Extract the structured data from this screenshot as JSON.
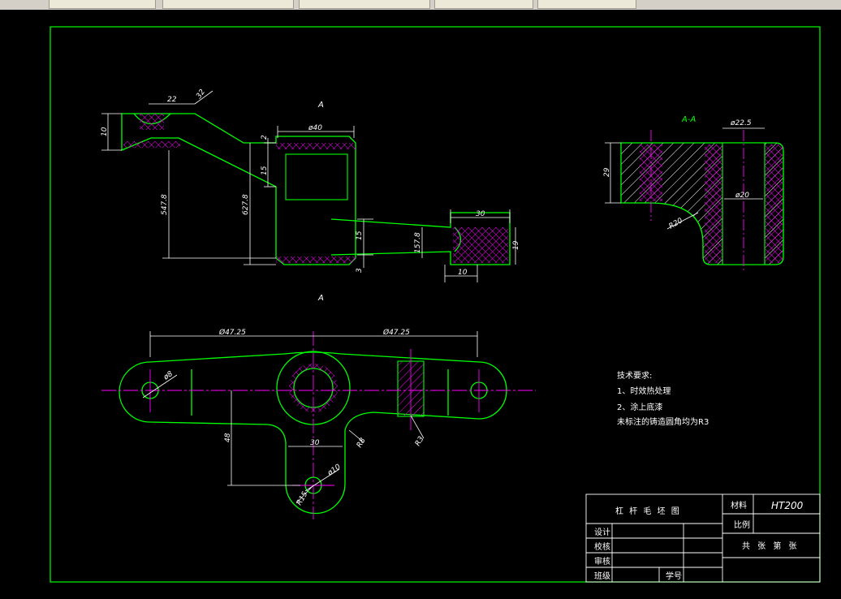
{
  "toolbar": {
    "tabs": [
      {
        "label": ""
      },
      {
        "label": ""
      },
      {
        "label": ""
      },
      {
        "label": ""
      },
      {
        "label": ""
      }
    ]
  },
  "drawing": {
    "view_a_top_label": "A",
    "view_a_bottom_label": "A",
    "section_label": "A-A",
    "dims": {
      "d22": "22",
      "d32": "32",
      "d10_left": "10",
      "d547": "547.8",
      "d6278": "627.8",
      "phi40": "ø40",
      "d2": "2",
      "d15a": "15",
      "d15b": "15",
      "d3": "3",
      "d1578": "157.8",
      "d30_right": "30",
      "d19": "19",
      "d10_right": "10",
      "phi225": "ø22.5",
      "d29": "29",
      "phi20": "ø20",
      "r20": "R20",
      "d4725_left": "Ø47.25",
      "d4725_right": "Ø47.25",
      "phi8": "ø8",
      "d48": "48",
      "d30_bottom": "30",
      "r8": "R8",
      "r3": "R3",
      "phi10": "ø10",
      "r15": "R15"
    },
    "notes": {
      "title": "技术要求:",
      "line1": "1、时效热处理",
      "line2": "2、涂上底漆",
      "line3": "未标注的铸造圆角均为R3"
    },
    "title_block": {
      "part_name": "杠 杆 毛 坯 图",
      "material_label": "材料",
      "material_value": "HT200",
      "scale_label": "比例",
      "sheets": "共 张 第 张",
      "design": "设计",
      "check": "校核",
      "review": "审核",
      "class": "班级",
      "student_id": "学号"
    }
  },
  "colors": {
    "background": "#000000",
    "frame": "#00ff00",
    "outline": "#00ff00",
    "dimension": "#ffffff",
    "centerline": "#ff00ff",
    "hatch": "#ff00ff",
    "section_label": "#00ff00"
  }
}
